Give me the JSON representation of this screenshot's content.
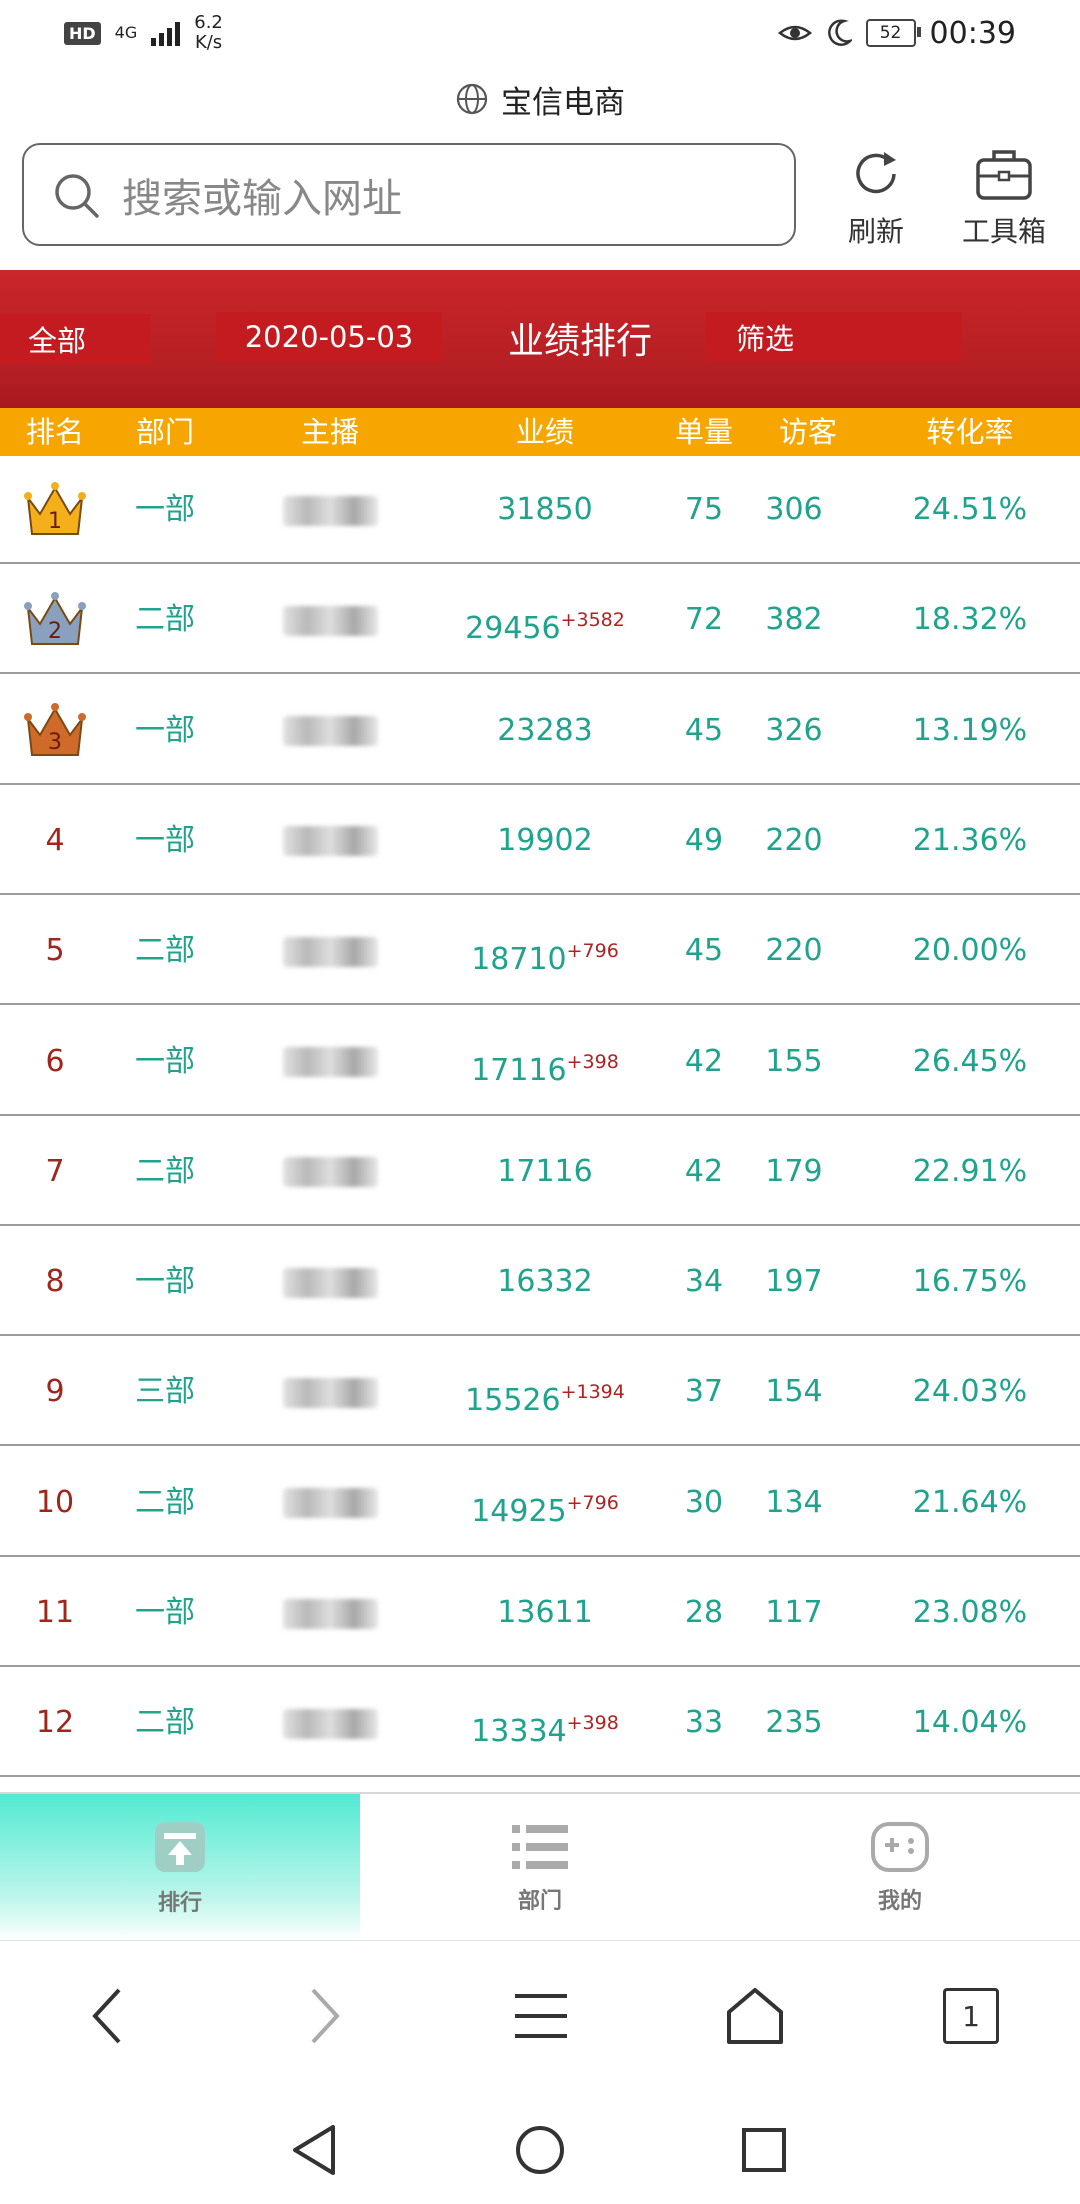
{
  "status_bar": {
    "hd": "HD",
    "network": "4G",
    "speed_value": "6.2",
    "speed_unit": "K/s",
    "battery": "52",
    "time": "00:39"
  },
  "browser": {
    "page_title": "宝信电商",
    "search_placeholder": "搜索或输入网址",
    "refresh_label": "刷新",
    "toolbox_label": "工具箱",
    "tab_count": "1"
  },
  "header": {
    "filter_all": "全部",
    "date": "2020-05-03",
    "title": "业绩排行",
    "filter": "筛选"
  },
  "columns": [
    "排名",
    "部门",
    "主播",
    "业绩",
    "单量",
    "访客",
    "转化率"
  ],
  "rows": [
    {
      "rank": "1",
      "dept": "一部",
      "perf": "31850",
      "delta": "",
      "orders": "75",
      "visitors": "306",
      "conv": "24.51%"
    },
    {
      "rank": "2",
      "dept": "二部",
      "perf": "29456",
      "delta": "+3582",
      "orders": "72",
      "visitors": "382",
      "conv": "18.32%"
    },
    {
      "rank": "3",
      "dept": "一部",
      "perf": "23283",
      "delta": "",
      "orders": "45",
      "visitors": "326",
      "conv": "13.19%"
    },
    {
      "rank": "4",
      "dept": "一部",
      "perf": "19902",
      "delta": "",
      "orders": "49",
      "visitors": "220",
      "conv": "21.36%"
    },
    {
      "rank": "5",
      "dept": "二部",
      "perf": "18710",
      "delta": "+796",
      "orders": "45",
      "visitors": "220",
      "conv": "20.00%"
    },
    {
      "rank": "6",
      "dept": "一部",
      "perf": "17116",
      "delta": "+398",
      "orders": "42",
      "visitors": "155",
      "conv": "26.45%"
    },
    {
      "rank": "7",
      "dept": "二部",
      "perf": "17116",
      "delta": "",
      "orders": "42",
      "visitors": "179",
      "conv": "22.91%"
    },
    {
      "rank": "8",
      "dept": "一部",
      "perf": "16332",
      "delta": "",
      "orders": "34",
      "visitors": "197",
      "conv": "16.75%"
    },
    {
      "rank": "9",
      "dept": "三部",
      "perf": "15526",
      "delta": "+1394",
      "orders": "37",
      "visitors": "154",
      "conv": "24.03%"
    },
    {
      "rank": "10",
      "dept": "二部",
      "perf": "14925",
      "delta": "+796",
      "orders": "30",
      "visitors": "134",
      "conv": "21.64%"
    },
    {
      "rank": "11",
      "dept": "一部",
      "perf": "13611",
      "delta": "",
      "orders": "28",
      "visitors": "117",
      "conv": "23.08%"
    },
    {
      "rank": "12",
      "dept": "二部",
      "perf": "13334",
      "delta": "+398",
      "orders": "33",
      "visitors": "235",
      "conv": "14.04%"
    }
  ],
  "bottom_nav": [
    {
      "label": "排行",
      "icon": "ranking-icon",
      "active": true
    },
    {
      "label": "部门",
      "icon": "list-icon",
      "active": false
    },
    {
      "label": "我的",
      "icon": "gamepad-icon",
      "active": false
    }
  ],
  "colors": {
    "header_red": "#c41b21",
    "column_header_orange": "#f7a500",
    "teal_text": "#20a38c",
    "rank_red": "#a0261c",
    "crown_gold": "#f3b01a",
    "crown_silver": "#8aa0bf",
    "crown_bronze": "#cf6a2a"
  }
}
